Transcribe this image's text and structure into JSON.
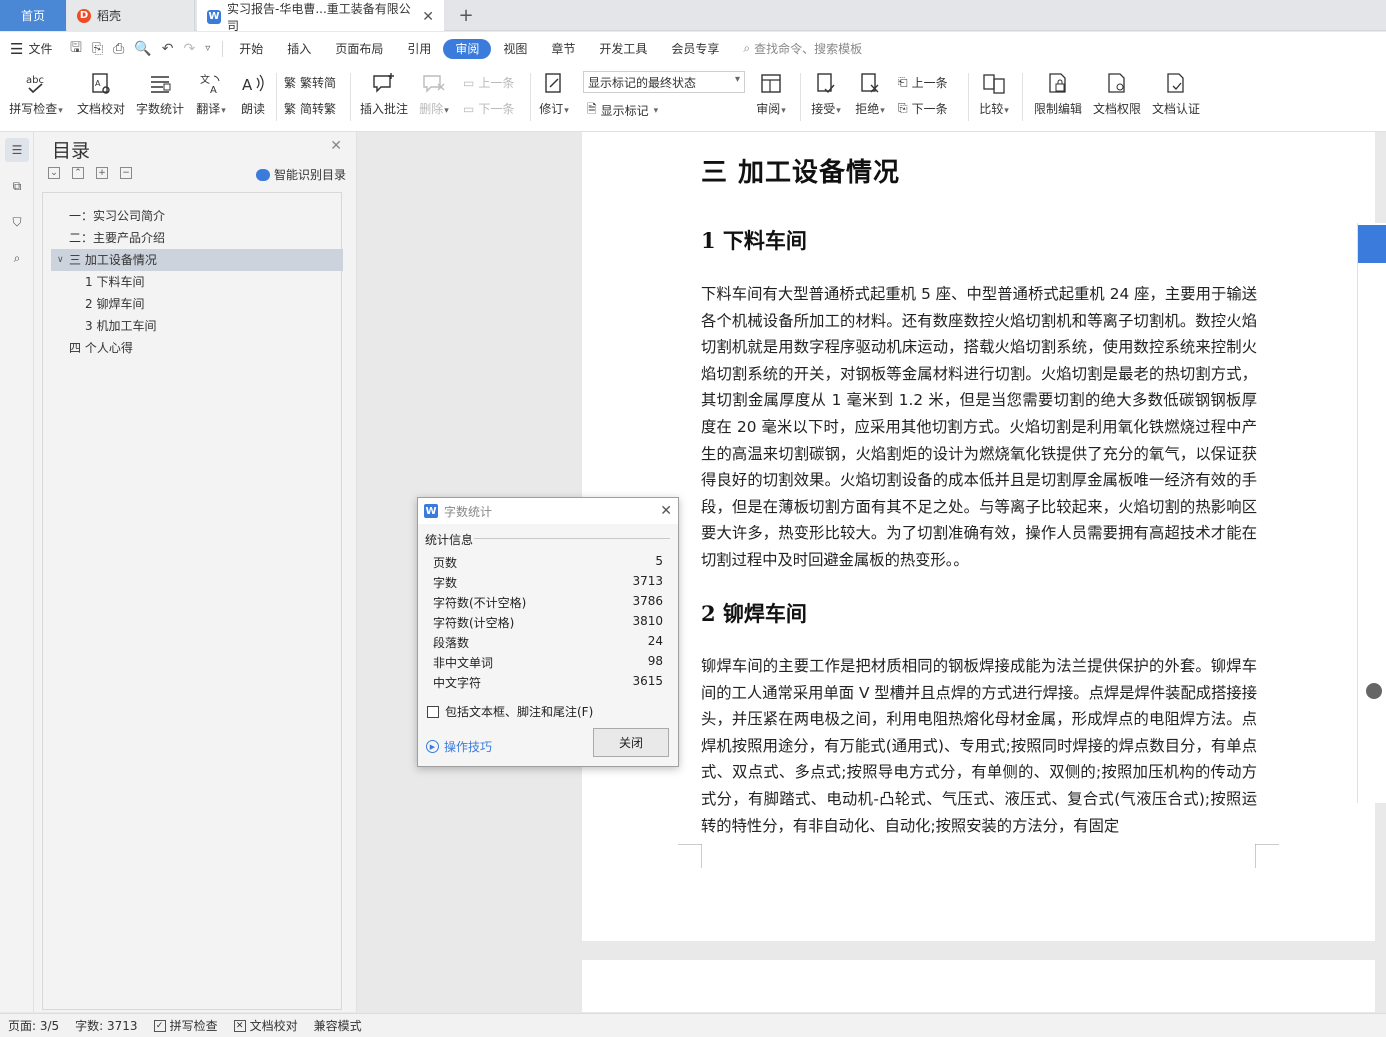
{
  "tabs": {
    "home": "首页",
    "daoke": "稻壳",
    "doc": "实习报告-华电曹...重工装备有限公司",
    "add": "+"
  },
  "menu": {
    "file": "文件",
    "items": [
      "开始",
      "插入",
      "页面布局",
      "引用",
      "审阅",
      "视图",
      "章节",
      "开发工具",
      "会员专享"
    ],
    "active": "审阅",
    "search_placeholder": "查找命令、搜索模板"
  },
  "ribbon": {
    "spellcheck": "拼写检查",
    "proofread": "文档校对",
    "wordcount": "字数统计",
    "translate": "翻译",
    "read_aloud": "朗读",
    "trad_to_simp": "繁转简",
    "simp_to_trad": "简转繁",
    "insert_comment": "插入批注",
    "delete": "删除",
    "prev_comment": "上一条",
    "next_comment": "下一条",
    "track_changes": "修订",
    "markup_mode": "显示标记的最终状态",
    "show_markup": "显示标记",
    "review": "审阅",
    "accept": "接受",
    "reject": "拒绝",
    "prev_change": "上一条",
    "next_change": "下一条",
    "compare": "比较",
    "restrict_edit": "限制编辑",
    "doc_permission": "文档权限",
    "doc_cert": "文档认证"
  },
  "toc": {
    "title": "目录",
    "smart": "智能识别目录",
    "items": [
      {
        "label": "一：实习公司简介",
        "level": 1
      },
      {
        "label": "二：主要产品介绍",
        "level": 1
      },
      {
        "label": "三  加工设备情况",
        "level": 1,
        "selected": true
      },
      {
        "label": "1 下料车间",
        "level": 2
      },
      {
        "label": "2 铆焊车间",
        "level": 2
      },
      {
        "label": "3 机加工车间",
        "level": 2
      },
      {
        "label": "四  个人心得",
        "level": 1
      }
    ]
  },
  "document": {
    "heading1": "三  加工设备情况",
    "section1_title": "1 下料车间",
    "section1_body": "下料车间有大型普通桥式起重机 5 座、中型普通桥式起重机 24 座，主要用于输送各个机械设备所加工的材料。还有数座数控火焰切割机和等离子切割机。数控火焰切割机就是用数字程序驱动机床运动，搭载火焰切割系统，使用数控系统来控制火焰切割系统的开关，对钢板等金属材料进行切割。火焰切割是最老的热切割方式，其切割金属厚度从 1 毫米到 1.2 米，但是当您需要切割的绝大多数低碳钢钢板厚度在 20 毫米以下时，应采用其他切割方式。火焰切割是利用氧化铁燃烧过程中产生的高温来切割碳钢，火焰割炬的设计为燃烧氧化铁提供了充分的氧气，以保证获得良好的切割效果。火焰切割设备的成本低并且是切割厚金属板唯一经济有效的手段，但是在薄板切割方面有其不足之处。与等离子比较起来，火焰切割的热影响区要大许多，热变形比较大。为了切割准确有效，操作人员需要拥有高超技术才能在切割过程中及时回避金属板的热变形。。",
    "section2_title": "2 铆焊车间",
    "section2_body": "铆焊车间的主要工作是把材质相同的钢板焊接成能为法兰提供保护的外套。铆焊车间的工人通常采用单面 V 型槽并且点焊的方式进行焊接。点焊是焊件装配成搭接接头，并压紧在两电极之间，利用电阻热熔化母材金属，形成焊点的电阻焊方法。点焊机按照用途分，有万能式(通用式)、专用式;按照同时焊接的焊点数目分，有单点式、双点式、多点式;按照导电方式分，有单侧的、双侧的;按照加压机构的传动方式分，有脚踏式、电动机-凸轮式、气压式、液压式、复合式(气液压合式);按照运转的特性分，有非自动化、自动化;按照安装的方法分，有固定"
  },
  "dialog": {
    "title": "字数统计",
    "section": "统计信息",
    "rows": [
      {
        "label": "页数",
        "value": "5"
      },
      {
        "label": "字数",
        "value": "3713"
      },
      {
        "label": "字符数(不计空格)",
        "value": "3786"
      },
      {
        "label": "字符数(计空格)",
        "value": "3810"
      },
      {
        "label": "段落数",
        "value": "24"
      },
      {
        "label": "非中文单词",
        "value": "98"
      },
      {
        "label": "中文字符",
        "value": "3615"
      }
    ],
    "checkbox": "包括文本框、脚注和尾注(F)",
    "tips": "操作技巧",
    "close": "关闭"
  },
  "status": {
    "page": "页面: 3/5",
    "words": "字数: 3713",
    "spell": "拼写检查",
    "proof": "文档校对",
    "compat": "兼容模式"
  }
}
